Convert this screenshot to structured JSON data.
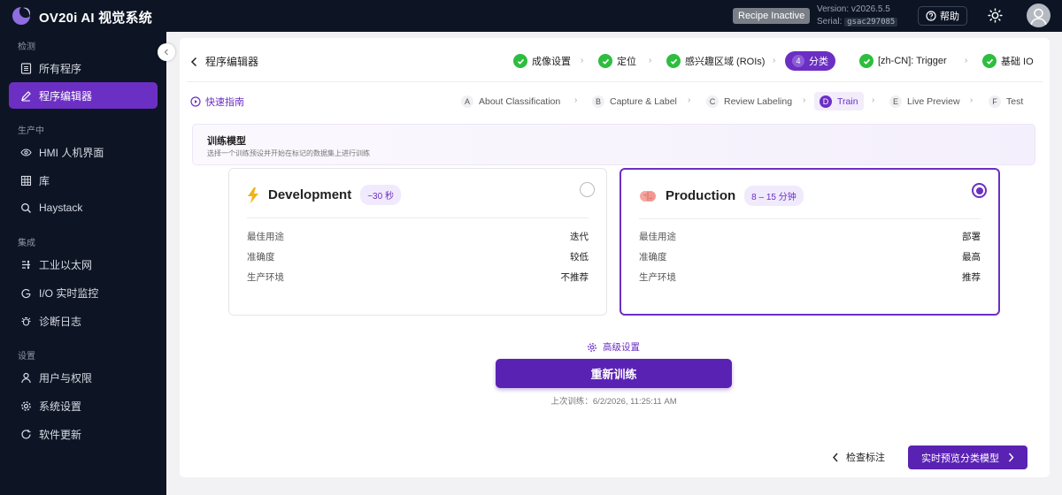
{
  "app": {
    "title": "OV20i AI 视觉系统",
    "recipe_status": "Recipe Inactive",
    "version": "Version: v2026.5.5",
    "serial_label": "Serial:",
    "serial_value": "gsac297085",
    "help_label": "帮助",
    "icons": {
      "logo": "ov-logo-icon",
      "help": "help-circle-icon",
      "theme": "sun-icon",
      "user": "user-avatar-icon"
    }
  },
  "sidebar": {
    "sections": [
      {
        "title": "检测",
        "items": [
          {
            "label": "所有程序",
            "icon": "list-icon"
          },
          {
            "label": "程序编辑器",
            "icon": "pencil-icon",
            "active": true
          }
        ]
      },
      {
        "title": "生产中",
        "items": [
          {
            "label": "HMI 人机界面",
            "icon": "eye-icon"
          },
          {
            "label": "库",
            "icon": "table-icon"
          },
          {
            "label": "Haystack",
            "icon": "search-icon"
          }
        ]
      },
      {
        "title": "集成",
        "items": [
          {
            "label": "工业以太网",
            "icon": "network-icon"
          },
          {
            "label": "I/O 实时监控",
            "icon": "io-icon"
          },
          {
            "label": "诊断日志",
            "icon": "bug-icon"
          }
        ]
      },
      {
        "title": "设置",
        "items": [
          {
            "label": "用户与权限",
            "icon": "user-icon"
          },
          {
            "label": "系统设置",
            "icon": "gear-icon"
          },
          {
            "label": "软件更新",
            "icon": "refresh-icon"
          }
        ]
      }
    ]
  },
  "editor": {
    "back_label": "程序编辑器",
    "steps": [
      {
        "label": "成像设置",
        "status": "done"
      },
      {
        "label": "定位",
        "status": "done"
      },
      {
        "label": "感兴趣区域 (ROIs)",
        "status": "done"
      },
      {
        "label": "分类",
        "number": "4",
        "status": "active"
      },
      {
        "label": "[zh-CN]: Trigger",
        "status": "done"
      },
      {
        "label": "基础 IO",
        "status": "done"
      }
    ],
    "quick_guide": "快速指南",
    "substeps": [
      {
        "letter": "A",
        "label": "About Classification"
      },
      {
        "letter": "B",
        "label": "Capture & Label"
      },
      {
        "letter": "C",
        "label": "Review Labeling"
      },
      {
        "letter": "D",
        "label": "Train",
        "active": true
      },
      {
        "letter": "E",
        "label": "Live Preview"
      },
      {
        "letter": "F",
        "label": "Test"
      }
    ]
  },
  "train": {
    "title": "训练模型",
    "subtitle": "选择一个训练预设并开始在标记的数据集上进行训练",
    "presets": [
      {
        "name": "Development",
        "time": "~30 秒",
        "icon": "lightning-icon",
        "selected": false,
        "rows": [
          {
            "k": "最佳用途",
            "v": "迭代"
          },
          {
            "k": "准确度",
            "v": "较低"
          },
          {
            "k": "生产环境",
            "v": "不推荐"
          }
        ]
      },
      {
        "name": "Production",
        "time": "8 – 15 分钟",
        "icon": "brain-icon",
        "selected": true,
        "rows": [
          {
            "k": "最佳用途",
            "v": "部署"
          },
          {
            "k": "准确度",
            "v": "最高"
          },
          {
            "k": "生产环境",
            "v": "推荐"
          }
        ]
      }
    ],
    "advanced_label": "高级设置",
    "retrain_label": "重新训练",
    "last_trained": "上次训练：6/2/2026, 11:25:11 AM"
  },
  "footer": {
    "review_label": "检查标注",
    "preview_label": "实时预览分类模型"
  },
  "colors": {
    "accent": "#6c2fc4",
    "button": "#5a22b3",
    "success": "#2ebd3f",
    "sidebar_bg": "#0d1525"
  }
}
